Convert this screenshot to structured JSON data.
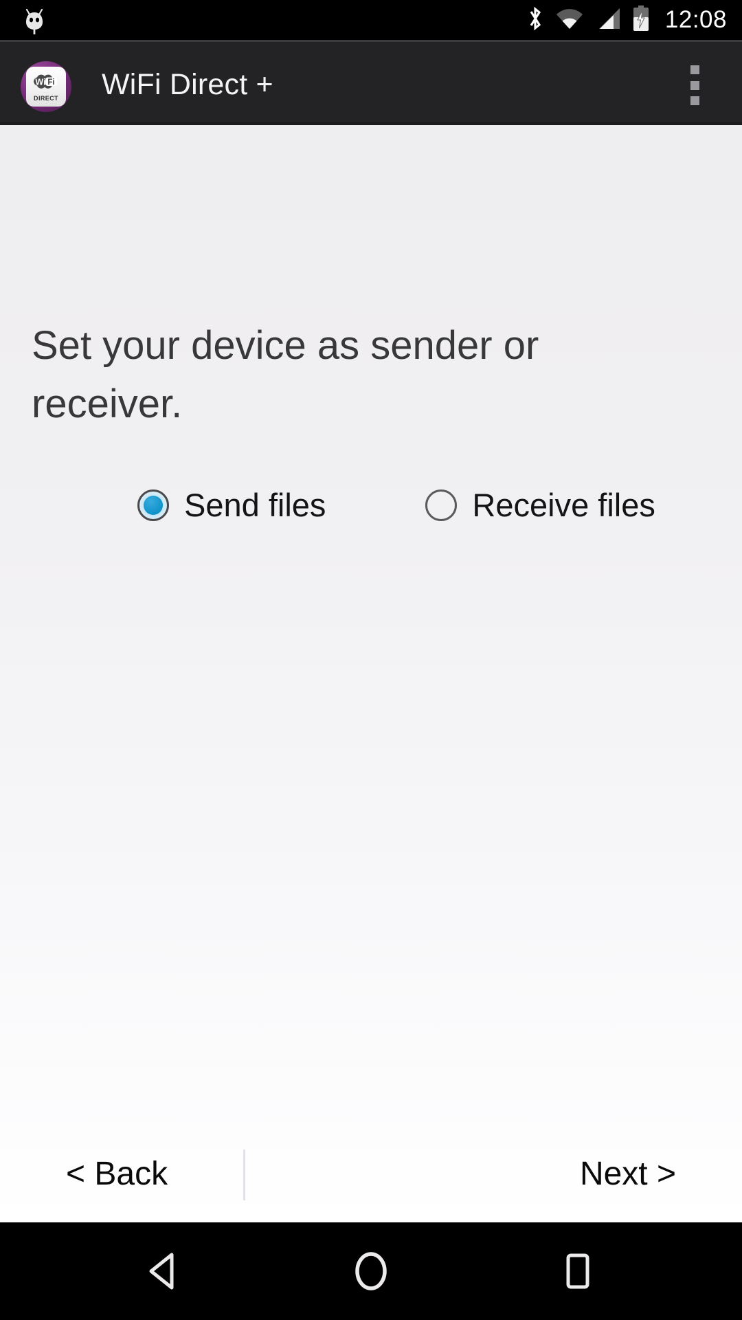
{
  "status_bar": {
    "clock": "12:08",
    "icons": [
      "android-debug-icon",
      "bluetooth-icon",
      "wifi-icon",
      "cellular-signal-icon",
      "battery-charging-icon"
    ],
    "background": "#000000",
    "foreground": "#ffffff"
  },
  "app_bar": {
    "title": "WiFi Direct +",
    "icon_name": "wifi-direct-app-icon",
    "icon_badge_text": "DIRECT",
    "icon_logo_text_left": "Wi",
    "icon_logo_text_right": "Fi",
    "overflow_label": "overflow-menu-icon",
    "background": "#232326",
    "title_color": "#f4f4f4",
    "accent": "#7a2f7d"
  },
  "main": {
    "headline": "Set your device as sender or receiver.",
    "headline_color": "#38383a",
    "options": [
      {
        "label": "Send files",
        "selected": true,
        "name": "radio-send-files"
      },
      {
        "label": "Receive files",
        "selected": false,
        "name": "radio-receive-files"
      }
    ],
    "selected_color": "#0f93c9",
    "unselected_color": "#5a5a5c"
  },
  "footer": {
    "back_label": "< Back",
    "next_label": "Next >",
    "text_color": "#0a0a0a",
    "divider_color": "#e2e2e6"
  },
  "nav_bar": {
    "back_label": "back-nav-icon",
    "home_label": "home-nav-icon",
    "recents_label": "recents-nav-icon",
    "background": "#000000"
  }
}
